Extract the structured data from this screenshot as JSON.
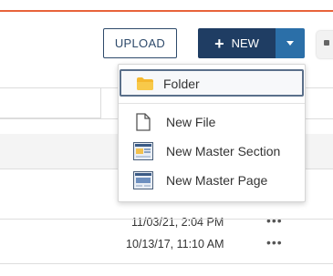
{
  "toolbar": {
    "upload_label": "UPLOAD",
    "new_label": "NEW",
    "new_plus_glyph": "+",
    "accent_color": "#e8633a",
    "primary_color": "#1f3d63",
    "toggle_color": "#2b6fa8"
  },
  "new_menu": {
    "items": [
      {
        "label": "Folder",
        "icon": "folder-icon",
        "active": true
      },
      {
        "label": "New File",
        "icon": "file-icon",
        "active": false
      },
      {
        "label": "New Master Section",
        "icon": "master-section-icon",
        "active": false
      },
      {
        "label": "New Master Page",
        "icon": "master-page-icon",
        "active": false
      }
    ]
  },
  "table": {
    "rows": [
      {
        "date": "11/03/21, 2:04 PM",
        "more": "•••"
      },
      {
        "date": "10/13/17, 11:10 AM",
        "more": "•••"
      }
    ]
  }
}
